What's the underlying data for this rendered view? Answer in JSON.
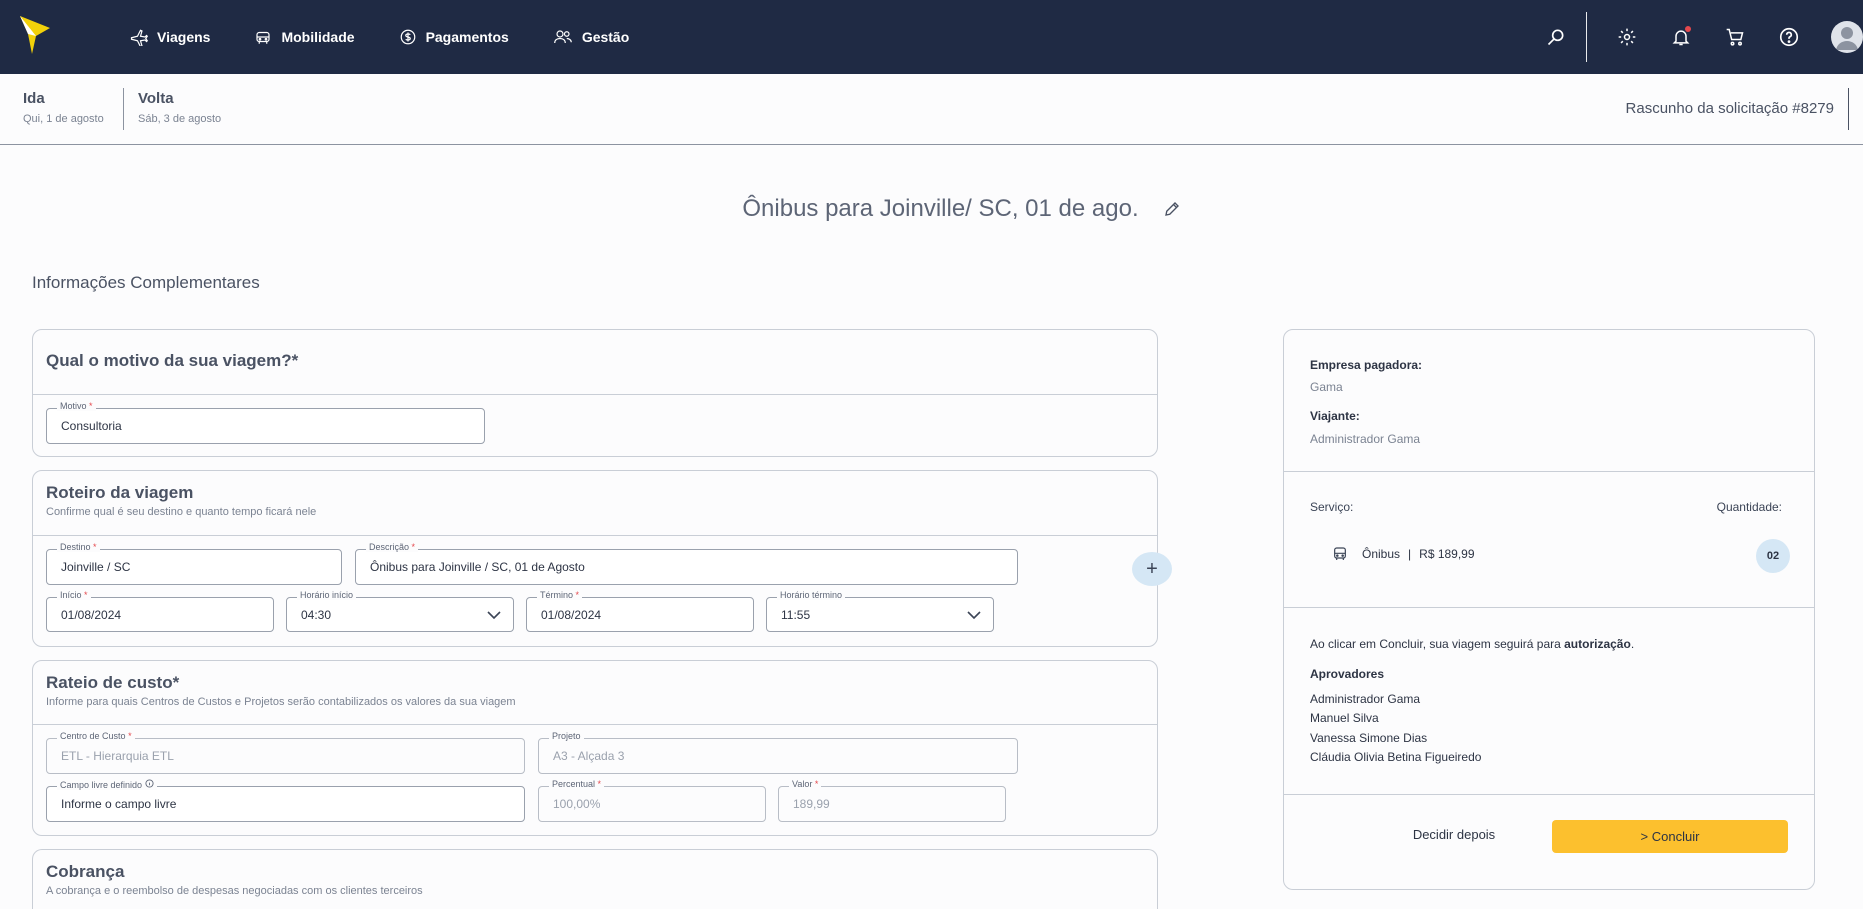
{
  "nav": {
    "items": [
      {
        "label": "Viagens",
        "icon": "plane-icon"
      },
      {
        "label": "Mobilidade",
        "icon": "car-icon"
      },
      {
        "label": "Pagamentos",
        "icon": "dollar-icon"
      },
      {
        "label": "Gestão",
        "icon": "users-icon"
      }
    ]
  },
  "trip": {
    "ida_label": "Ida",
    "ida_date": "Qui, 1 de agosto",
    "volta_label": "Volta",
    "volta_date": "Sáb, 3 de agosto",
    "draft": "Rascunho da solicitação #8279"
  },
  "page": {
    "title": "Ônibus para Joinville/ SC, 01 de ago.",
    "section": "Informações Complementares"
  },
  "motivo": {
    "title": "Qual o motivo da sua viagem?",
    "field_label": "Motivo",
    "value": "Consultoria"
  },
  "roteiro": {
    "title": "Roteiro da viagem",
    "subtitle": "Confirme qual é seu destino e quanto tempo ficará nele",
    "destino_label": "Destino",
    "destino": "Joinville / SC",
    "descricao_label": "Descrição",
    "descricao": "Ônibus para Joinville / SC, 01 de Agosto",
    "inicio_label": "Início",
    "inicio": "01/08/2024",
    "hora_inicio_label": "Horário início",
    "hora_inicio": "04:30",
    "termino_label": "Término",
    "termino": "01/08/2024",
    "hora_termino_label": "Horário término",
    "hora_termino": "11:55",
    "add_symbol": "+"
  },
  "rateio": {
    "title": "Rateio de custo",
    "subtitle": "Informe para quais Centros de Custos e Projetos serão contabilizados os valores da sua viagem",
    "centro_label": "Centro de Custo",
    "centro": "ETL - Hierarquia ETL",
    "projeto_label": "Projeto",
    "projeto": "A3 - Alçada 3",
    "campo_label": "Campo livre definido",
    "campo_placeholder": "Informe o campo livre",
    "percentual_label": "Percentual",
    "percentual": "100,00%",
    "valor_label": "Valor",
    "valor": "189,99"
  },
  "cobranca": {
    "title": "Cobrança",
    "subtitle": "A cobrança e o reembolso de despesas negociadas com os clientes terceiros"
  },
  "summary": {
    "empresa_label": "Empresa pagadora:",
    "empresa": "Gama",
    "viajante_label": "Viajante:",
    "viajante": "Administrador Gama",
    "servico_label": "Serviço:",
    "quantidade_label": "Quantidade:",
    "service_name": "Ônibus",
    "service_sep": "|",
    "service_price": "R$ 189,99",
    "quantity": "02",
    "notice_pre": "Ao clicar em Concluir, sua viagem seguirá para ",
    "notice_bold": "autorização",
    "notice_post": ".",
    "approvers_label": "Aprovadores",
    "approvers": [
      "Administrador Gama",
      "Manuel Silva",
      "Vanessa Simone Dias",
      "Cláudia Olivia Betina Figueiredo"
    ],
    "later_button": "Decidir depois",
    "conclude_button": "> Concluir"
  },
  "colors": {
    "nav_bg": "#1f2a44",
    "accent": "#fcc02e",
    "badge_bg": "#d5e7f5",
    "required": "#e5484d"
  }
}
